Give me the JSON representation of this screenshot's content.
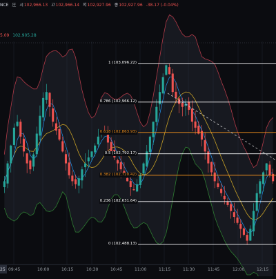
{
  "legend": {
    "row1_prefix": "NCE",
    "row1_exchange_badge": "圧",
    "open_label": "시",
    "open_value": "102,966.13",
    "high_label": "고",
    "high_value": "102,966.14",
    "low_label": "저",
    "low_value": "102,927.96",
    "close_label": "종",
    "close_value": "102,927.96",
    "change_value": "-38.17 (-0.04%)",
    "row2_value1": "5.09",
    "row2_value2": "102,905.28"
  },
  "fibonacci": [
    {
      "label": "1 (103,096.22)",
      "color": "#ffffff"
    },
    {
      "label": "0.786 (102,966.12)",
      "color": "#ffffff"
    },
    {
      "label": "0.618 (102,863.93)",
      "color": "#f7941d"
    },
    {
      "label": "0.5 (102,792.17)",
      "color": "#ffffff"
    },
    {
      "label": "0.382 (102,720.42)",
      "color": "#f7941d"
    },
    {
      "label": "0.236 (102,631.64)",
      "color": "#ffffff"
    },
    {
      "label": "0 (102,488.13)",
      "color": "#ffffff"
    }
  ],
  "time_axis": [
    "09:45",
    "10:00",
    "10:15",
    "10:30",
    "10:45",
    "11:00",
    "11:15",
    "11:30",
    "11:45",
    "12:00",
    "12:15"
  ],
  "time_axis_left_fragment": "25",
  "colors": {
    "background": "#0b0c10",
    "bull": "#26a69a",
    "bear": "#ef5350",
    "fib_line": "#ffffff",
    "fib_accent": "#f7941d",
    "bb_upper": "#b23a48",
    "bb_lower": "#2e7d32",
    "bb_basis": "#c9a227",
    "ma_blue": "#2196f3"
  },
  "chart_data": {
    "type": "candlestick",
    "x": [
      "09:45",
      "10:00",
      "10:15",
      "10:30",
      "10:45",
      "11:00",
      "11:15",
      "11:30",
      "11:45",
      "12:00",
      "12:15"
    ],
    "fib_levels": [
      {
        "ratio": 1,
        "price": 103096.22
      },
      {
        "ratio": 0.786,
        "price": 102966.12
      },
      {
        "ratio": 0.618,
        "price": 102863.93
      },
      {
        "ratio": 0.5,
        "price": 102792.17
      },
      {
        "ratio": 0.382,
        "price": 102720.42
      },
      {
        "ratio": 0.236,
        "price": 102631.64
      },
      {
        "ratio": 0,
        "price": 102488.13
      }
    ],
    "close_series": [
      102700,
      102760,
      102820,
      102880,
      102900,
      102850,
      102800,
      102760,
      102740,
      102790,
      102860,
      102920,
      102980,
      103000,
      102950,
      102900,
      102870,
      102840,
      102800,
      102760,
      102720,
      102700,
      102690,
      102710,
      102740,
      102760,
      102780,
      102800,
      102820,
      102850,
      102870,
      102860,
      102830,
      102800,
      102780,
      102760,
      102740,
      102720,
      102700,
      102680,
      102670,
      102690,
      102720,
      102760,
      102800,
      102850,
      102900,
      102950,
      103000,
      103050,
      103090,
      103060,
      103000,
      102980,
      102960,
      102950,
      102960,
      102940,
      102900,
      102880,
      102860,
      102840,
      102800,
      102760,
      102730,
      102700,
      102680,
      102660,
      102640,
      102620,
      102600,
      102580,
      102560,
      102540,
      102520,
      102500,
      102540,
      102600,
      102660,
      102700,
      102730,
      102760,
      102720,
      102700
    ],
    "ylim": [
      102420,
      103170
    ]
  }
}
